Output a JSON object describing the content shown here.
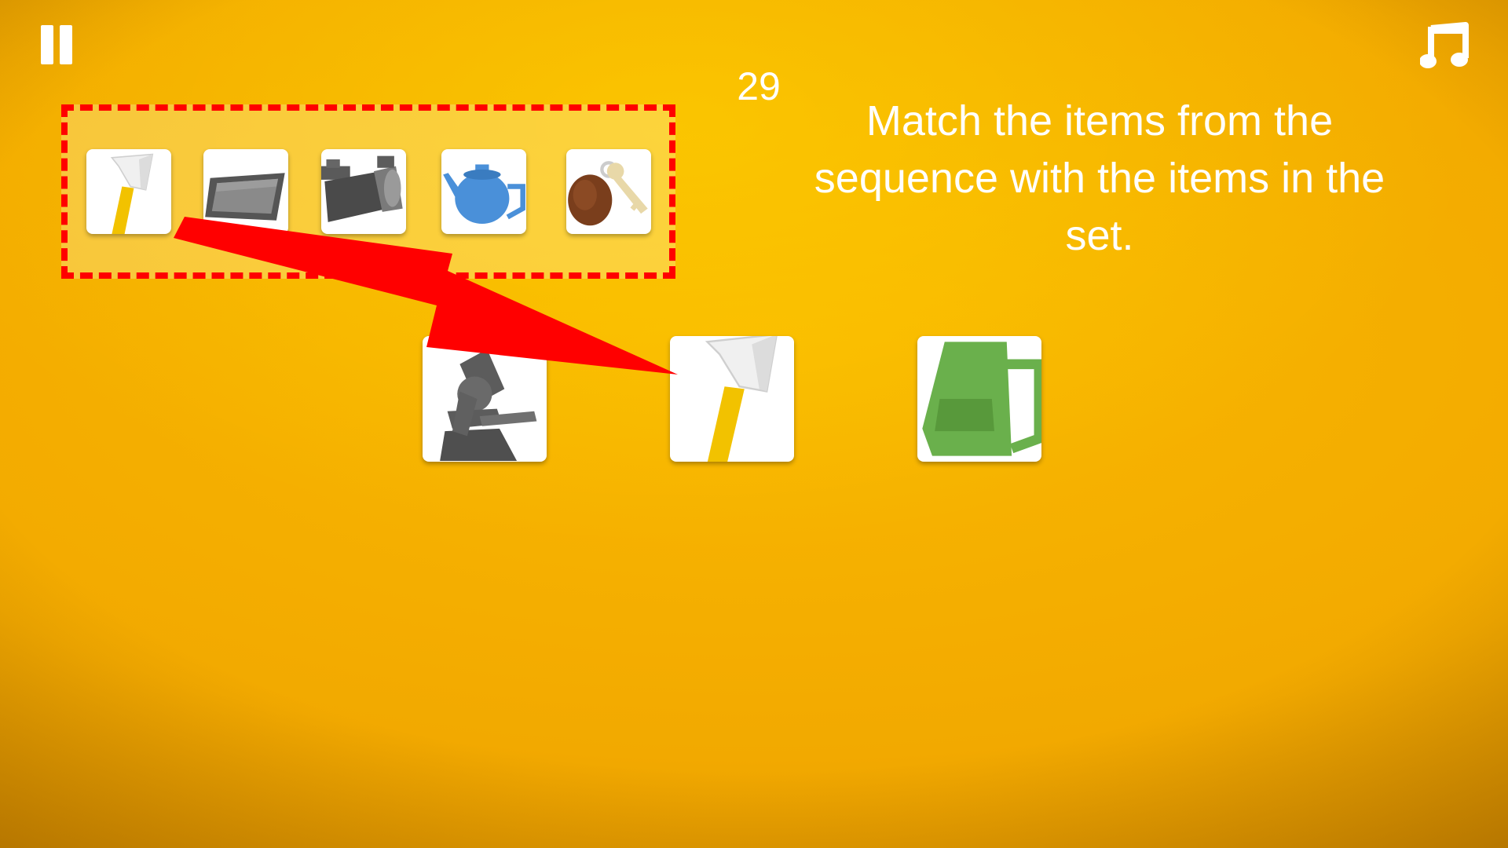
{
  "game": {
    "timer": "29",
    "instruction": "Match the items from the sequence with the items in the set."
  },
  "controls": {
    "pause_icon": "pause-icon",
    "music_icon": "music-note-icon"
  },
  "sequence": [
    {
      "item": "axe",
      "icon": "axe-icon"
    },
    {
      "item": "tablet",
      "icon": "tablet-icon"
    },
    {
      "item": "video camera",
      "icon": "video-camera-icon"
    },
    {
      "item": "teapot",
      "icon": "teapot-icon"
    },
    {
      "item": "key with keychain",
      "icon": "key-icon"
    }
  ],
  "set": [
    {
      "item": "microscope",
      "icon": "microscope-icon"
    },
    {
      "item": "axe",
      "icon": "axe-icon"
    },
    {
      "item": "mug",
      "icon": "mug-icon"
    }
  ],
  "hint_arrow": {
    "color": "#ff0000",
    "from": "sequence item 1",
    "to": "set item 2"
  },
  "colors": {
    "background": "#f5b000",
    "highlight_border": "#ff0000",
    "text": "#ffffff"
  }
}
